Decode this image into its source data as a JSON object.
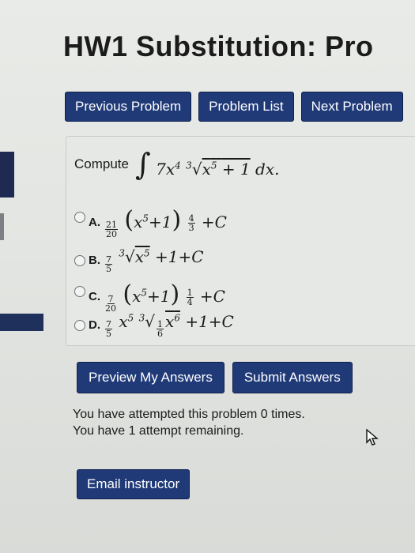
{
  "page": {
    "title": "HW1 Substitution: Pro"
  },
  "nav": {
    "previous": "Previous Problem",
    "list": "Problem List",
    "next": "Next Problem"
  },
  "problem": {
    "prompt": "Compute",
    "integrand_coeff": "7x",
    "integrand_exp": "4",
    "root_index": "3",
    "radicand_base": "x",
    "radicand_exp": "5",
    "radicand_rest": "+ 1",
    "differential": "dx."
  },
  "options": [
    {
      "letter": "A.",
      "num": "21",
      "den": "20",
      "base": "x",
      "exp": "5",
      "inner": "+1",
      "outer_num": "4",
      "outer_den": "3",
      "tail": "+C"
    },
    {
      "letter": "B.",
      "num": "7",
      "den": "5",
      "root": "3",
      "base": "x",
      "exp": "5",
      "tail": "+1+C"
    },
    {
      "letter": "C.",
      "num": "7",
      "den": "20",
      "base": "x",
      "exp": "5",
      "inner": "+1",
      "outer_num": "1",
      "outer_den": "4",
      "tail": "+C"
    },
    {
      "letter": "D.",
      "num": "7",
      "den": "5",
      "base": "x",
      "exp": "5",
      "root": "3",
      "inner_num": "1",
      "inner_den": "6",
      "inner_base": "x",
      "inner_exp": "6",
      "tail": "+1+C"
    }
  ],
  "actions": {
    "preview": "Preview My Answers",
    "submit": "Submit Answers"
  },
  "attempts": {
    "line1": "You have attempted this problem 0 times.",
    "line2": "You have 1 attempt remaining."
  },
  "email": "Email instructor"
}
